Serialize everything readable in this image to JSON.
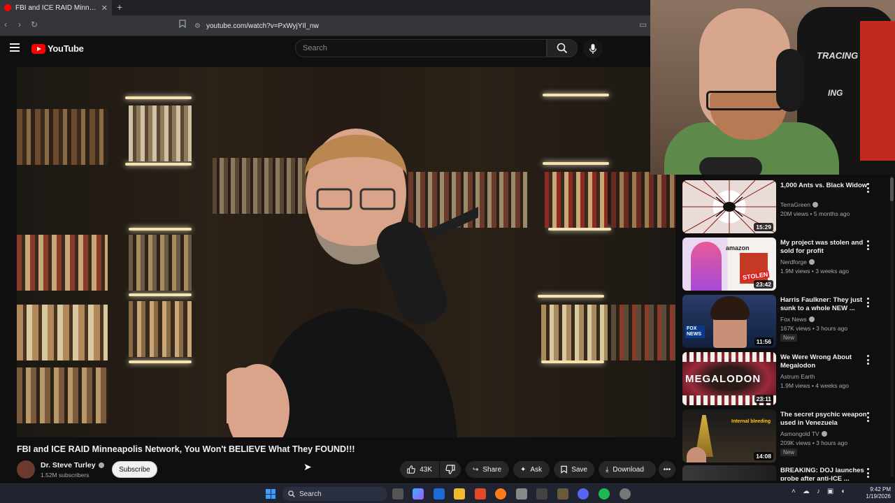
{
  "browser": {
    "tab_title": "FBI and ICE RAID Minneapolis N",
    "new_tab_symbol": "+",
    "url": "youtube.com/watch?v=PxWyjYIl_nw"
  },
  "header": {
    "logo_text": "YouTube",
    "search_placeholder": "Search"
  },
  "video": {
    "title": "FBI and ICE RAID Minneapolis Network, You Won't BELIEVE What They FOUND!!!",
    "channel": "Dr. Steve Turley",
    "subscribers": "1.52M subscribers",
    "subscribe_label": "Subscribe",
    "likes": "43K",
    "share_label": "Share",
    "ask_label": "Ask",
    "save_label": "Save",
    "download_label": "Download"
  },
  "webcam": {
    "chair_text_1": "TRACING",
    "chair_text_2": "ING"
  },
  "recommendations": [
    {
      "title": "1,000 Ants vs. Black Widow",
      "channel": "TerraGreen",
      "verified": true,
      "meta": "20M views • 5 months ago",
      "duration": "15:29",
      "badge": ""
    },
    {
      "title": "My project was stolen and sold for profit",
      "channel": "Nerdforge",
      "verified": true,
      "meta": "1.9M views • 3 weeks ago",
      "duration": "23:42",
      "badge": ""
    },
    {
      "title": "Harris Faulkner: They just sunk to a whole NEW ...",
      "channel": "Fox News",
      "verified": true,
      "meta": "167K views • 3 hours ago",
      "duration": "11:56",
      "badge": "New"
    },
    {
      "title": "We Were Wrong About Megalodon",
      "channel": "Astrum Earth",
      "verified": false,
      "meta": "1.9M views • 4 weeks ago",
      "duration": "23:11",
      "badge": ""
    },
    {
      "title": "The secret psychic weapon used in Venezuela",
      "channel": "Asmongold TV",
      "verified": true,
      "meta": "209K views • 3 hours ago",
      "duration": "14:08",
      "badge": "New"
    },
    {
      "title": "BREAKING: DOJ launches probe after anti-ICE ...",
      "channel": "",
      "verified": false,
      "meta": "",
      "duration": "",
      "badge": ""
    }
  ],
  "thumb_texts": {
    "amazon": "amazon",
    "stolen": "STOLEN",
    "fox": "FOX NEWS",
    "megalodon": "MEGALODON",
    "internal": "Internal bleeding"
  },
  "taskbar": {
    "search_label": "Search",
    "time": "9:42 PM",
    "date": "1/19/2026"
  },
  "colors": {
    "background": "#0f0f0f",
    "brand_red": "#ff0000",
    "button_bg": "#272727"
  }
}
